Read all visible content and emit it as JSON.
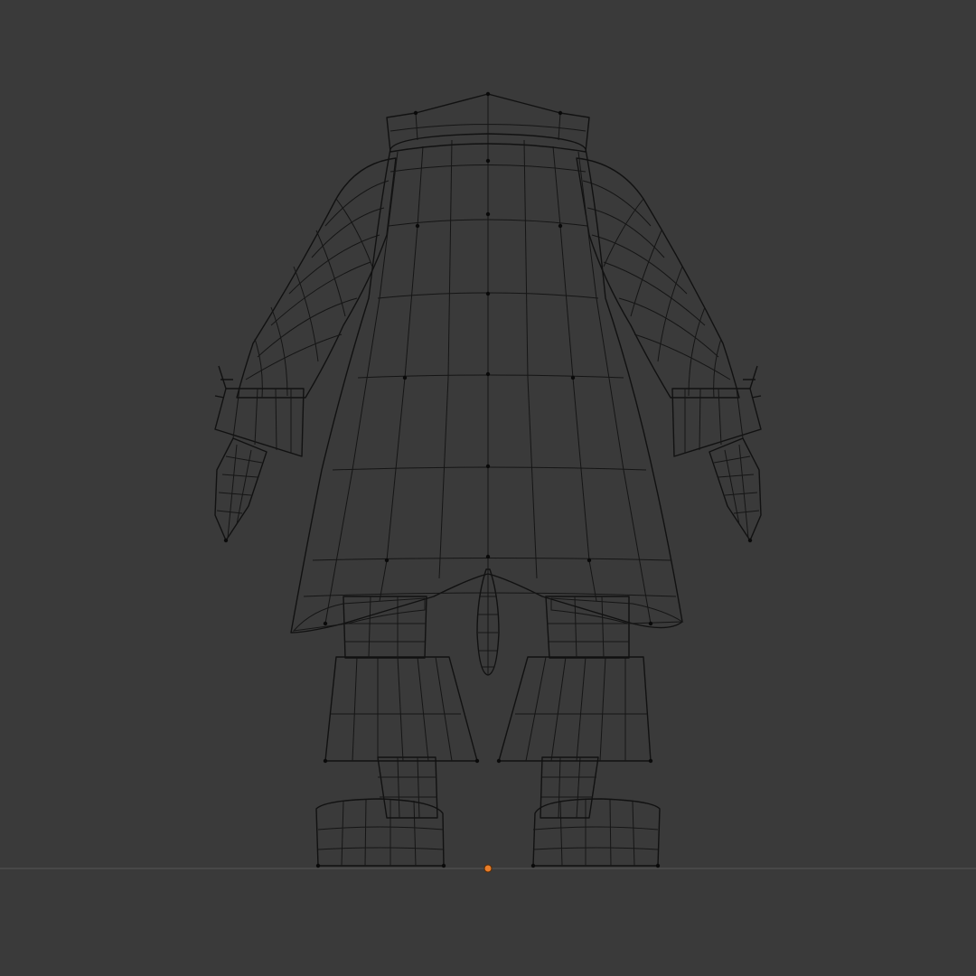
{
  "viewport": {
    "background": "#3a3a3a",
    "shading": "solid-wireframe",
    "mesh_fill": "#c4c4d0",
    "mesh_highlight": "#e6e6ee",
    "mesh_shadow": "#8a8a9e",
    "wire_color": "#111111",
    "ground_line_color": "#4a4a4a",
    "origin_color": "#e87d2a"
  },
  "model": {
    "parts": [
      "collar",
      "coat",
      "left-sleeve",
      "right-sleeve",
      "left-cuff",
      "right-cuff",
      "left-hand",
      "right-hand",
      "tail",
      "left-leg",
      "right-leg",
      "left-pant-cuff",
      "right-pant-cuff",
      "left-shoe",
      "right-shoe"
    ],
    "object_origin": "origin-point-icon"
  }
}
